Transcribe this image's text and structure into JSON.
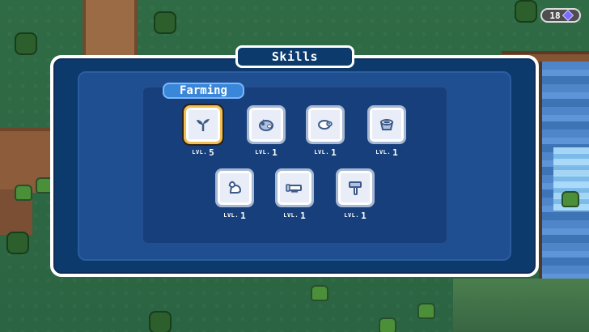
{
  "hud": {
    "crystal_count": "18",
    "crystal_icon": "crystal-icon"
  },
  "modal": {
    "title": "Skills"
  },
  "category": {
    "name": "Farming"
  },
  "skills": [
    {
      "icon": "sprout-icon",
      "level_label": "LVL.",
      "level_value": "5"
    },
    {
      "icon": "pig-icon",
      "level_label": "LVL.",
      "level_value": "1"
    },
    {
      "icon": "sheep-icon",
      "level_label": "LVL.",
      "level_value": "1"
    },
    {
      "icon": "pot-icon",
      "level_label": "LVL.",
      "level_value": "1"
    },
    {
      "icon": "chicken-icon",
      "level_label": "LVL.",
      "level_value": "1"
    },
    {
      "icon": "saw-icon",
      "level_label": "LVL.",
      "level_value": "1"
    },
    {
      "icon": "hammer-icon",
      "level_label": "LVL.",
      "level_value": "1"
    }
  ],
  "colors": {
    "modal_bg": "#0c3a6d",
    "panel_bg": "#173f7b",
    "highlight": "#f1be52",
    "tab_bg": "#3a86d8"
  }
}
